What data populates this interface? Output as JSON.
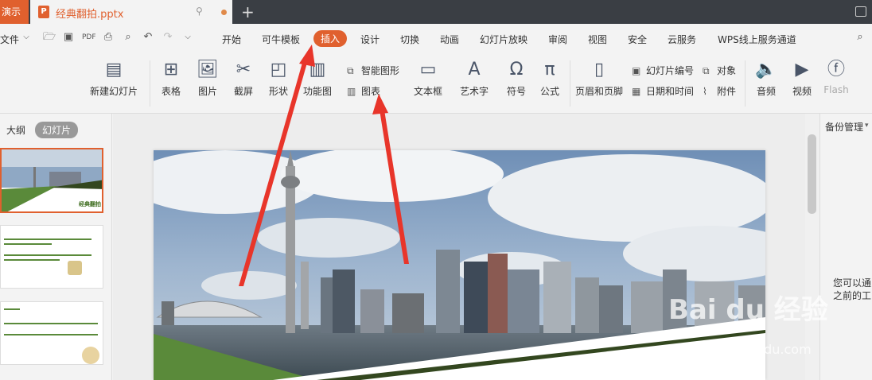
{
  "titlebar": {
    "left_tab_label": "演示",
    "doc_icon": "P",
    "doc_name": "经典翻拍.pptx",
    "pin_icon": "pin-icon",
    "add_tab": "+"
  },
  "menubar": {
    "file_label": "文件",
    "tabs": [
      "开始",
      "可牛模板",
      "插入",
      "设计",
      "切换",
      "动画",
      "幻灯片放映",
      "审阅",
      "视图",
      "安全",
      "云服务",
      "WPS线上服务通道"
    ],
    "active_tab": "插入"
  },
  "ribbon": {
    "new_slide": "新建幻灯片",
    "table": "表格",
    "picture": "图片",
    "screenshot": "截屏",
    "shape": "形状",
    "function_chart": "功能图",
    "smart_art": "智能图形",
    "chart": "图表",
    "textbox": "文本框",
    "art_text": "艺术字",
    "symbol": "符号",
    "formula": "公式",
    "header_footer": "页眉和页脚",
    "slide_number": "幻灯片编号",
    "date_time": "日期和时间",
    "object": "对象",
    "attachment": "附件",
    "audio": "音频",
    "video": "视频",
    "flash": "Flash"
  },
  "left_panel": {
    "outline_tab": "大纲",
    "slides_tab": "幻灯片",
    "thumb1_title": "经典翻拍"
  },
  "right_panel": {
    "backup": "备份管理",
    "line1": "您可以通",
    "line2": "之前的工"
  },
  "watermark": {
    "brand": "Bai du 经验",
    "url": "jingyan.baidu.com"
  },
  "colors": {
    "accent": "#e0602e",
    "titlebar": "#3a3e44",
    "green": "#5a8a3a",
    "dark_green": "#33471f",
    "arrow_red": "#e8352a"
  }
}
